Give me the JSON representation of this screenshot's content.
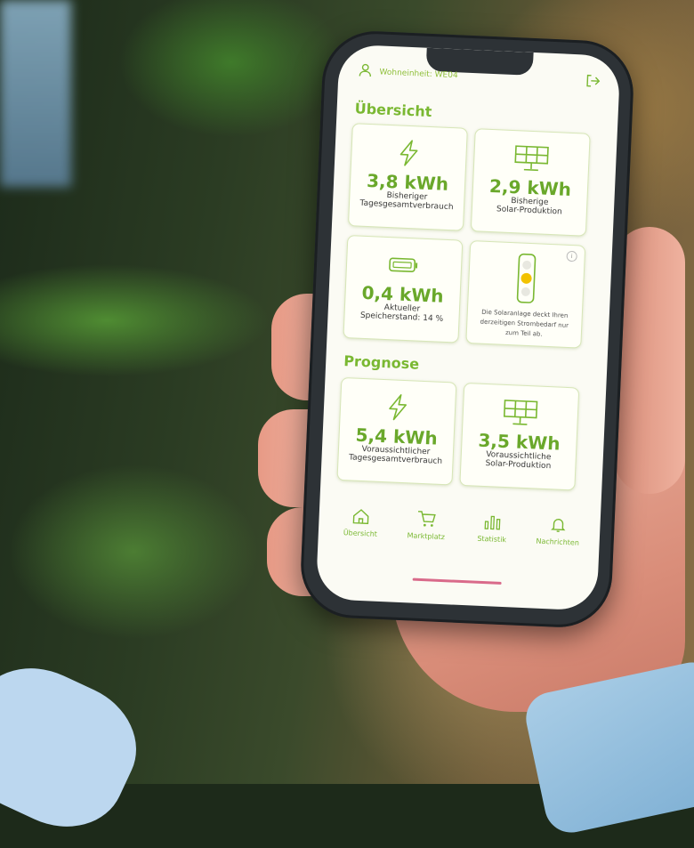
{
  "header": {
    "unit_label": "Wohneinheit: WE04",
    "icons": {
      "profile": "user-icon",
      "logout": "logout-icon"
    }
  },
  "overview": {
    "title": "Übersicht",
    "cards": [
      {
        "icon": "lightning-icon",
        "value": "3,8 kWh",
        "label_line1": "Bisheriger",
        "label_line2": "Tagesgesamtverbrauch"
      },
      {
        "icon": "solar-panel-icon",
        "value": "2,9 kWh",
        "label_line1": "Bisherige",
        "label_line2": "Solar-Produktion"
      },
      {
        "icon": "battery-icon",
        "value": "0,4 kWh",
        "label_line1": "Aktueller",
        "label_line2": "Speicherstand: 14 %"
      },
      {
        "icon": "traffic-light-icon",
        "message": "Die Solaranlage deckt Ihren derzeitigen Strombedarf nur zum Teil ab."
      }
    ]
  },
  "forecast": {
    "title": "Prognose",
    "cards": [
      {
        "icon": "lightning-icon",
        "value": "5,4 kWh",
        "label_line1": "Voraussichtlicher",
        "label_line2": "Tagesgesamtverbrauch"
      },
      {
        "icon": "solar-panel-icon",
        "value": "3,5 kWh",
        "label_line1": "Voraussichtliche",
        "label_line2": "Solar-Produktion"
      }
    ]
  },
  "nav": [
    {
      "label": "Übersicht",
      "icon": "home-icon"
    },
    {
      "label": "Marktplatz",
      "icon": "cart-icon"
    },
    {
      "label": "Statistik",
      "icon": "bar-chart-icon"
    },
    {
      "label": "Nachrichten",
      "icon": "bell-icon"
    }
  ],
  "colors": {
    "accent": "#7ab832",
    "value": "#6aa82b",
    "traffic_yellow": "#f2c200"
  }
}
